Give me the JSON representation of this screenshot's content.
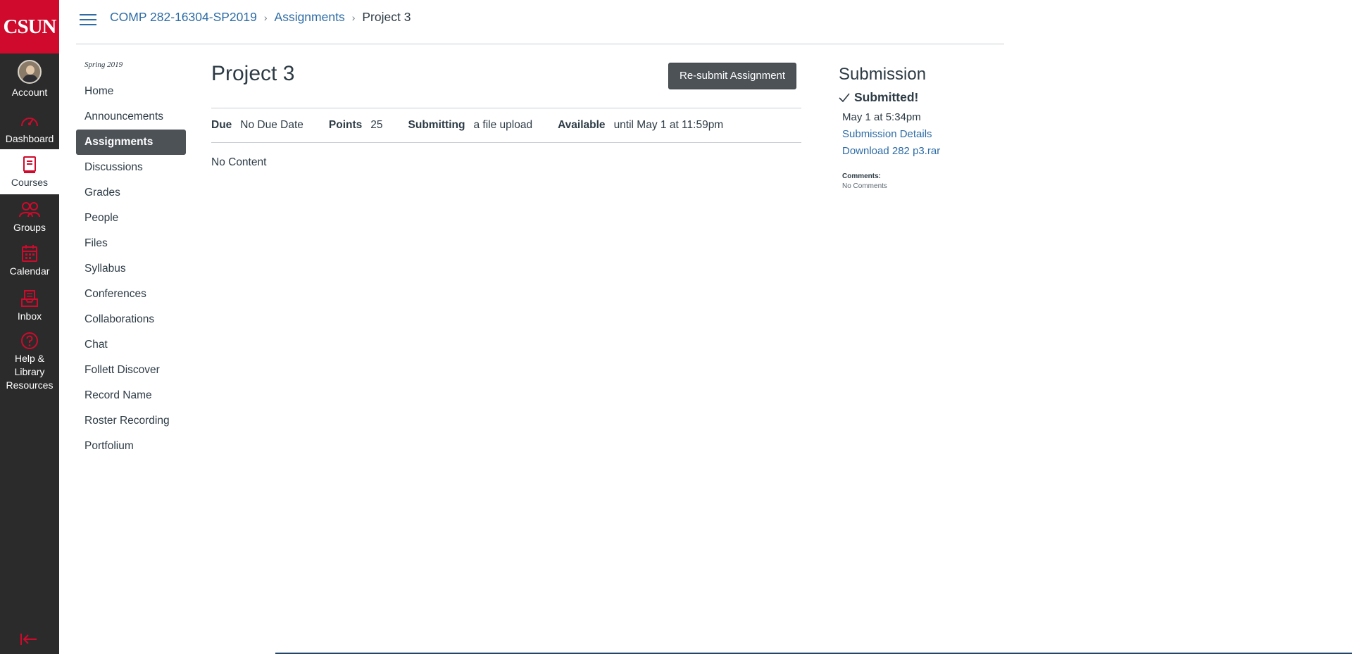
{
  "global_nav": {
    "logo": "CSUN",
    "account": "Account",
    "dashboard": "Dashboard",
    "courses": "Courses",
    "groups": "Groups",
    "calendar": "Calendar",
    "inbox": "Inbox",
    "help": "Help & Library Resources",
    "brand_color": "#cf0a2c",
    "nav_bg": "#2b2b2b"
  },
  "breadcrumb": {
    "course": "COMP 282-16304-SP2019",
    "section": "Assignments",
    "current": "Project 3",
    "separator": "›"
  },
  "course_nav": {
    "term": "Spring 2019",
    "items": [
      {
        "label": "Home"
      },
      {
        "label": "Announcements"
      },
      {
        "label": "Assignments",
        "active": true
      },
      {
        "label": "Discussions"
      },
      {
        "label": "Grades"
      },
      {
        "label": "People"
      },
      {
        "label": "Files"
      },
      {
        "label": "Syllabus"
      },
      {
        "label": "Conferences"
      },
      {
        "label": "Collaborations"
      },
      {
        "label": "Chat"
      },
      {
        "label": "Follett Discover"
      },
      {
        "label": "Record Name"
      },
      {
        "label": "Roster Recording"
      },
      {
        "label": "Portfolium"
      }
    ]
  },
  "assignment": {
    "title": "Project 3",
    "resubmit_label": "Re-submit Assignment",
    "due_label": "Due",
    "due_value": "No Due Date",
    "points_label": "Points",
    "points_value": "25",
    "submitting_label": "Submitting",
    "submitting_value": "a file upload",
    "available_label": "Available",
    "available_value": "until May 1 at 11:59pm",
    "body": "No Content"
  },
  "submission": {
    "title": "Submission",
    "status": "Submitted!",
    "date": "May 1 at 5:34pm",
    "details_link": "Submission Details",
    "download_link": "Download 282 p3.rar",
    "comments_label": "Comments:",
    "comments_value": "No Comments"
  }
}
